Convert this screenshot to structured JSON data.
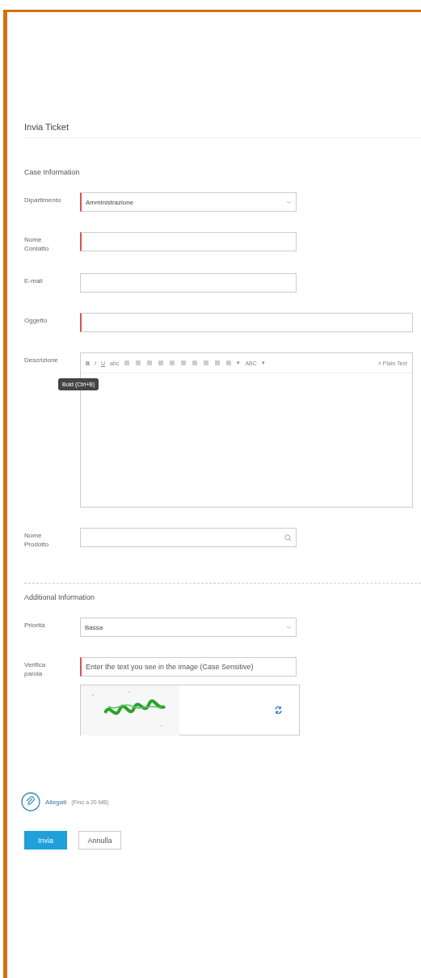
{
  "title": "Invia Ticket",
  "case_section": {
    "heading": "Case Information",
    "fields": [
      {
        "kind": "select",
        "label": "Dipartimento",
        "value": "Amministrazione",
        "required": true,
        "wide": false
      },
      {
        "kind": "text",
        "label": "Nome Contatto",
        "required": true,
        "wide": false
      },
      {
        "kind": "text",
        "label": "E-mail",
        "required": false,
        "wide": false
      },
      {
        "kind": "text",
        "label": "Oggetto",
        "required": true,
        "wide": true
      },
      {
        "kind": "editor",
        "label": "Descrizione",
        "required": false,
        "wide": true
      },
      {
        "kind": "lookup",
        "label": "Nome Prodotto",
        "required": false,
        "wide": false
      }
    ]
  },
  "editor": {
    "toolbar": [
      {
        "kind": "text",
        "label": "B"
      },
      {
        "kind": "text",
        "label": "I"
      },
      {
        "kind": "text",
        "label": "U"
      },
      {
        "kind": "text",
        "label": "abc"
      },
      {
        "kind": "icon"
      },
      {
        "kind": "icon"
      },
      {
        "kind": "icon"
      },
      {
        "kind": "icon"
      },
      {
        "kind": "icon"
      },
      {
        "kind": "icon"
      },
      {
        "kind": "icon"
      },
      {
        "kind": "icon"
      },
      {
        "kind": "icon"
      },
      {
        "kind": "icon"
      },
      {
        "kind": "text",
        "label": "▾"
      },
      {
        "kind": "text",
        "label": "ABC"
      },
      {
        "kind": "text",
        "label": "▾"
      }
    ],
    "mode_link": "« Plain Text",
    "tooltip": "Bold (Ctrl+B)"
  },
  "additional_section": {
    "heading": "Additional Information",
    "fields": [
      {
        "kind": "select",
        "label": "Priorità",
        "value": "Bassa",
        "required": false,
        "wide": false
      },
      {
        "kind": "captcha",
        "label": "Verifica parola",
        "placeholder": "Enter the text you see in the image (Case Sensitive)",
        "required": true,
        "wide": false
      }
    ]
  },
  "attachments": {
    "label": "Allegati",
    "note": "(Fino a 20 MB)"
  },
  "buttons": [
    {
      "kind": "primary",
      "label": "Invia"
    },
    {
      "kind": "secondary",
      "label": "Annulla"
    }
  ]
}
